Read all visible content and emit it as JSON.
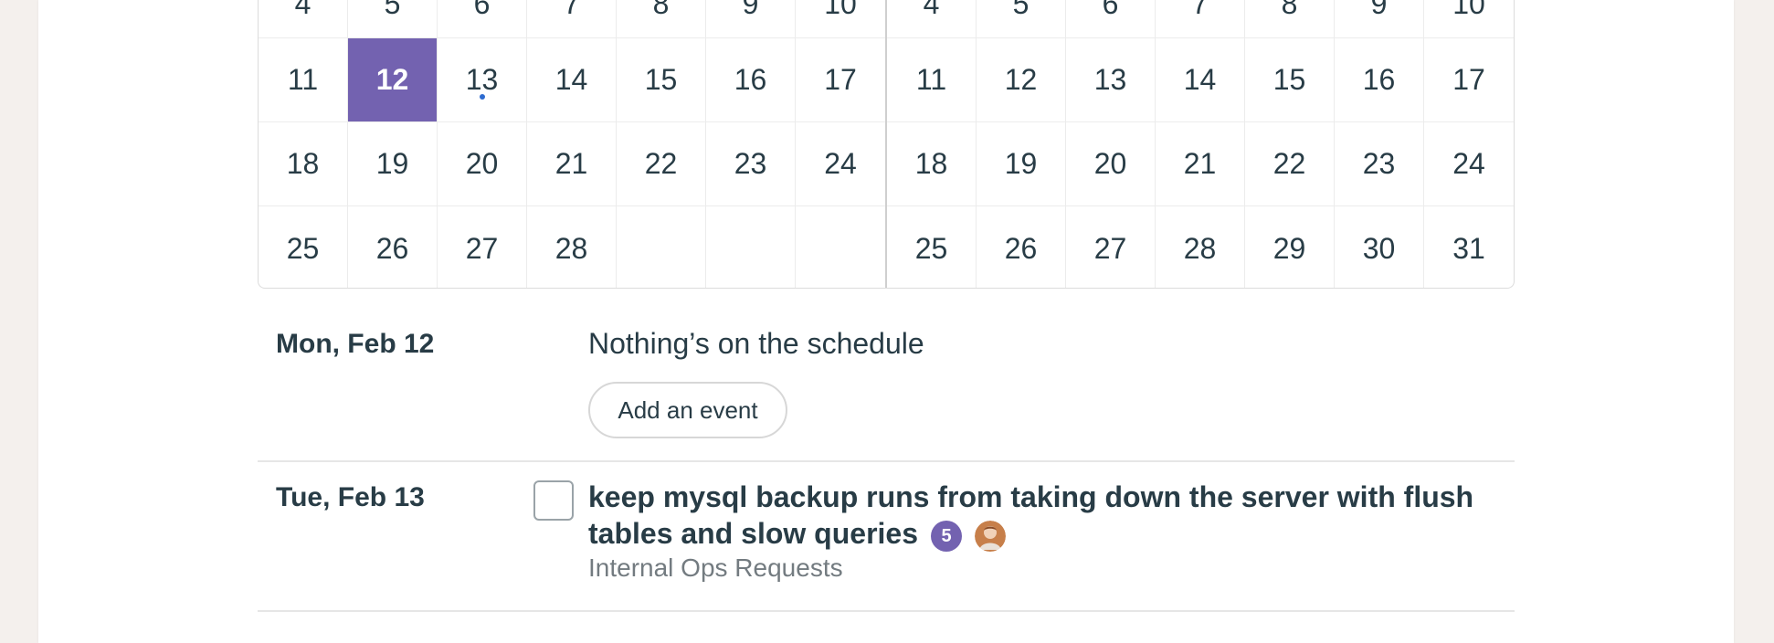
{
  "calendar": {
    "left_month": {
      "top_row": [
        "4",
        "5",
        "6",
        "7",
        "8",
        "9",
        "10"
      ],
      "weeks": [
        [
          "11",
          "12",
          "13",
          "14",
          "15",
          "16",
          "17"
        ],
        [
          "18",
          "19",
          "20",
          "21",
          "22",
          "23",
          "24"
        ],
        [
          "25",
          "26",
          "27",
          "28",
          "",
          "",
          ""
        ]
      ]
    },
    "right_month": {
      "top_row": [
        "4",
        "5",
        "6",
        "7",
        "8",
        "9",
        "10"
      ],
      "weeks": [
        [
          "11",
          "12",
          "13",
          "14",
          "15",
          "16",
          "17"
        ],
        [
          "18",
          "19",
          "20",
          "21",
          "22",
          "23",
          "24"
        ],
        [
          "25",
          "26",
          "27",
          "28",
          "29",
          "30",
          "31"
        ]
      ]
    },
    "selected_day": "12",
    "event_dot_day": "13",
    "accent_color": "#7362b0",
    "dot_color": "#2d6bd0"
  },
  "agenda": {
    "day1": {
      "date": "Mon, Feb 12",
      "empty_text": "Nothing’s on the schedule",
      "add_label": "Add an event"
    },
    "day2": {
      "date": "Tue, Feb 13",
      "todo_title": "keep mysql backup runs from taking down the server with flush tables and slow queries",
      "comment_count": "5",
      "avatar_icon": "person-avatar-icon",
      "project": "Internal Ops Requests"
    }
  }
}
